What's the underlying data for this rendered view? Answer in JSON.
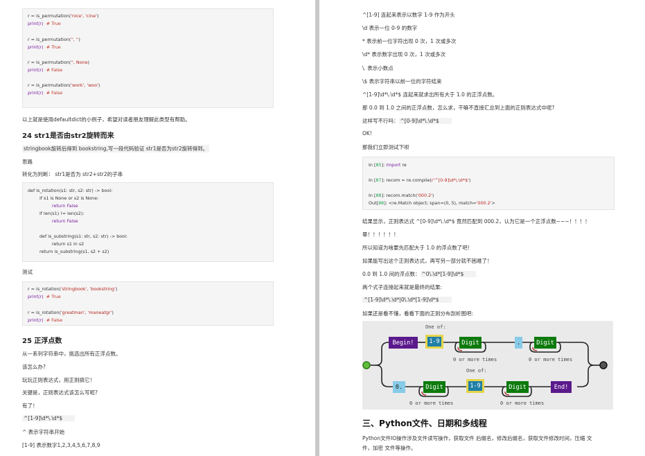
{
  "left": {
    "code1": [
      {
        "a": "r = is_permutation(",
        "s": "'nice', 'cine'",
        ")": ")"
      },
      {
        "p": "print(r)",
        "c": "# True"
      },
      {
        "a": "r = is_permutation(",
        "s": "'', ''",
        ")": ")"
      },
      {
        "p": "print(r)",
        "c": "# True"
      },
      {
        "a": "r = is_permutation(",
        "s": "'', None",
        ")": ")"
      },
      {
        "p": "print(r)",
        "c": "# False"
      },
      {
        "a": "r = is_permutation(",
        "s": "'work', 'woo'",
        ")": ")"
      },
      {
        "p": "print(r)",
        "c": "# False"
      }
    ],
    "intro": "以上就是使用defaultdict的小例子，希望对读者朋友理解此类型有帮助。",
    "h24": "24 str1是否由str2旋转而来",
    "p24": "stringbook旋转后得到 bookstring,写一段代码验证 str1是否为str2旋转得到。",
    "silu": "思路",
    "zhuanhua": "转化为判断： str1是否为 str2+str2的子串",
    "code2": {
      "l1": "def is_rotation(s1: str, s2: str) -> bool:",
      "l2": "if s1 is None or s2 is None:",
      "l3": "return False",
      "l4": "if len(s1) != len(s2):",
      "l5": "return False",
      "l6": "def is_substring(s1: str, s2: str) -> bool:",
      "l7": "return s1 in s2",
      "l8": "return is_substring(s1, s2 + s2)"
    },
    "ceshi": "测试",
    "code3": [
      {
        "a": "r = is_rotation(",
        "s": "'stringbook', 'bookstring'",
        ")": ")"
      },
      {
        "p": "print(r)",
        "c": "# True"
      },
      {
        "a": "r = is_rotation(",
        "s": "'greatman', 'maneatgr'",
        ")": ")"
      },
      {
        "p": "print(r)",
        "c": "# False"
      }
    ],
    "h25": "25 正浮点数",
    "p25a": "从一系列字符串中，挑选出所有正浮点数。",
    "p25b": "该怎么办?",
    "p25c": "玩玩正则表达式，用正则搞它！",
    "p25d": "关键是，正则表达式该怎么写呢?",
    "p25e": "有了！",
    "regex1": "^[1-9]\\d*\\.\\d*$",
    "p25f": "^ 表示字符串开始",
    "p25g": "[1-9] 表示数字1,2,3,4,5,6,7,8,9"
  },
  "right": {
    "r1": "^[1-9] 连起来表示以数字 1-9 作为开头",
    "r2": "\\d 表示一位 0-9 的数字",
    "r3": "* 表示前一位字符出现 0 次，1 次或多次",
    "r4": "\\d* 表示数字出现 0 次，1 次或多次",
    "r5": "\\. 表示小数点",
    "r6": "\\$ 表示字符串以前一位的字符结束",
    "r7": "^[1-9]\\d*\\.\\d*$ 连起来就求出所有大于 1.0 的正浮点数。",
    "r8": "那 0.0 到 1.0 之间的正浮点数，怎么求，干嘛不直接汇总到上面的正则表达式中呢?",
    "r9a": "这样写不行吗：",
    "r9b": "^[0-9]\\d*\\.\\d*$",
    "r10": "OK!",
    "r11": "那我们立即测试下呗",
    "code4": {
      "i85p": "In [",
      "i85n": "85",
      "i85s": "]: ",
      "i85k": "import",
      "i85r": " re",
      "i87p": "In [",
      "i87n": "87",
      "i87s": "]: recom = re.compile(",
      "i87str": "r'^[0-9]\\d*\\.\\d*$'",
      "i87e": ")",
      "i88p": "In [",
      "i88n": "88",
      "i88s": "]: recom.match(",
      "i88str": "'000.2'",
      "i88e": ")",
      "o88p": "Out[",
      "o88n": "88",
      "o88s": "]: <re.Match object; span=(0, 5), match=",
      "o88str": "'000.2'",
      "o88e": ">"
    },
    "r12": "结果显示，正则表达式 ^[0-9]\\d*\\.\\d*$ 竟然匹配到 000.2，认为它是一个正浮点数~~~！！！！",
    "r13": "晕！！！！！！",
    "r14": "所以知道为啥要先匹配大于 1.0 的浮点数了吧！",
    "r15": "如果能写出这个正则表达式，再写另一部分就不困难了！",
    "r16a": "0.0 到 1.0 间的浮点数：",
    "r16b": "^0\\.\\d*[1-9]\\d*$",
    "r17": "两个式子连接起来就是最终的结果:",
    "r18": "^[1-9]\\d*\\.\\d*|0\\.\\d*[1-9]\\d*$",
    "r19": "如果还是看不懂，看看下面的正则分布剖析图吧:",
    "diagram": {
      "begin": "Begin!",
      "oneof1": "One of:",
      "r19a": "1-9",
      "digit": "Digit",
      "dot": ".",
      "oneof2": "One of:",
      "zero": "0.",
      "end": "End!",
      "omt": "0 or more times"
    },
    "h3": "三、Python文件、日期和多线程",
    "p3a": "Python文件IO操作涉及文件读写操作，获取文件 后缀名，修改后缀名，获取文件修改时间，压缩 文",
    "p3b": "件，加密 文件等操作。"
  },
  "colors": {
    "begin_purple": "#5b1a8c",
    "digit_green": "#0d7a0d",
    "range_blue": "#1f7fa6",
    "yellow_border": "#e6d54a",
    "dot_blue": "#87cbe8"
  }
}
